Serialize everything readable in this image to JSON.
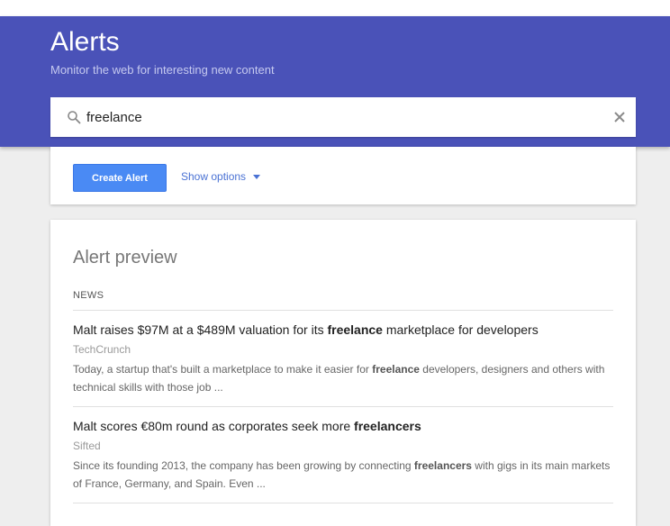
{
  "header": {
    "title": "Alerts",
    "subtitle": "Monitor the web for interesting new content",
    "bg_color": "#4a52b8"
  },
  "search": {
    "value": "freelance",
    "search_icon": "search-icon",
    "clear_icon": "close-icon"
  },
  "options": {
    "create_label": "Create Alert",
    "show_options_label": "Show options",
    "accent_color": "#4a8af4"
  },
  "preview": {
    "title": "Alert preview",
    "section_label": "NEWS",
    "results": [
      {
        "title_before": "Malt raises $97M at a $489M valuation for its ",
        "title_bold": "freelance",
        "title_after": " marketplace for developers",
        "source": "TechCrunch",
        "snippet_before": "Today, a startup that's built a marketplace to make it easier for ",
        "snippet_bold": "freelance",
        "snippet_after": " developers, designers and others with technical skills with those job ..."
      },
      {
        "title_before": "Malt scores €80m round as corporates seek more ",
        "title_bold": "freelancers",
        "title_after": "",
        "source": "Sifted",
        "snippet_before": "Since its founding 2013, the company has been growing by connecting ",
        "snippet_bold": "freelancers",
        "snippet_after": " with gigs in its main markets of France, Germany, and Spain. Even ..."
      }
    ]
  }
}
